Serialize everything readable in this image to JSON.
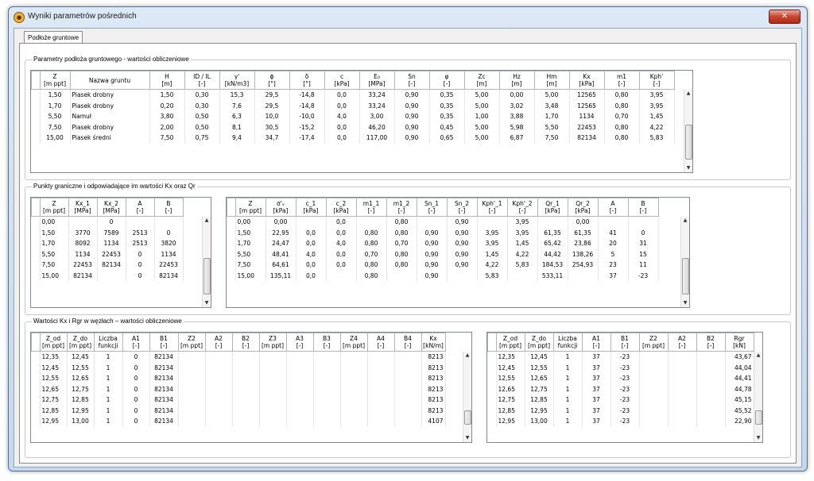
{
  "window": {
    "title": "Wyniki parametrów pośrednich",
    "close_label": "✕"
  },
  "tabs": [
    {
      "label": "Podłoże gruntowe"
    }
  ],
  "group1": {
    "label": "Parametry podłoża gruntowego - wartości obliczeniowe",
    "headers": [
      "Z\n[m ppt]",
      "Nazwa gruntu",
      "H\n[m]",
      "ID / IL\n[-]",
      "γ'\n[kN/m3]",
      "ϕ\n[°]",
      "δ\n[°]",
      "c\n[kPa]",
      "E₀\n[MPa]",
      "Sn\n[-]",
      "φ\n[-]",
      "Zc\n[m]",
      "Hz\n[m]",
      "Hm\n[m]",
      "Kx\n[kPa]",
      "m1\n[-]",
      "Kph'\n[-]"
    ],
    "rows": [
      [
        "1,50",
        "Piasek drobny",
        "1,50",
        "0,30",
        "15,3",
        "29,5",
        "-14,8",
        "0,0",
        "33,24",
        "0,90",
        "0,35",
        "5,00",
        "0,00",
        "5,00",
        "12565",
        "0,80",
        "3,95"
      ],
      [
        "1,70",
        "Piasek drobny",
        "0,20",
        "0,30",
        "7,6",
        "29,5",
        "-14,8",
        "0,0",
        "33,24",
        "0,90",
        "0,35",
        "5,00",
        "3,02",
        "3,48",
        "12565",
        "0,80",
        "3,95"
      ],
      [
        "5,50",
        "Namuł",
        "3,80",
        "0,50",
        "6,3",
        "10,0",
        "-10,0",
        "4,0",
        "3,00",
        "0,90",
        "0,35",
        "1,00",
        "3,88",
        "1,70",
        "1134",
        "0,70",
        "1,45"
      ],
      [
        "7,50",
        "Piasek drobny",
        "2,00",
        "0,50",
        "8,1",
        "30,5",
        "-15,2",
        "0,0",
        "46,20",
        "0,90",
        "0,45",
        "5,00",
        "5,98",
        "5,50",
        "22453",
        "0,80",
        "4,22"
      ],
      [
        "15,00",
        "Piasek średni",
        "7,50",
        "0,75",
        "9,4",
        "34,7",
        "-17,4",
        "0,0",
        "117,00",
        "0,90",
        "0,65",
        "5,00",
        "6,87",
        "7,50",
        "82134",
        "0,80",
        "5,83"
      ]
    ]
  },
  "group2": {
    "label": "Punkty graniczne i odpowiadające im wartości Kx oraz Qr",
    "left_headers": [
      "Z\n[m ppt]",
      "Kx_1\n[MPa]",
      "Kx_2\n[MPa]",
      "A\n[-]",
      "B\n[-]"
    ],
    "left_rows": [
      [
        "0,00",
        "",
        "0",
        "",
        ""
      ],
      [
        "1,50",
        "3770",
        "7589",
        "2513",
        "0"
      ],
      [
        "1,70",
        "8092",
        "1134",
        "2513",
        "3820"
      ],
      [
        "5,50",
        "1134",
        "22453",
        "0",
        "1134"
      ],
      [
        "7,50",
        "22453",
        "82134",
        "0",
        "22453"
      ],
      [
        "15,00",
        "82134",
        "",
        "0",
        "82134"
      ]
    ],
    "right_headers": [
      "Z\n[m ppt]",
      "σ'ᵥ\n[kPa]",
      "c_1\n[kPa]",
      "c_2\n[kPa]",
      "m1_1\n[-]",
      "m1_2\n[-]",
      "Sn_1\n[-]",
      "Sn_2\n[-]",
      "Kph'_1\n[-]",
      "Kph'_2\n[-]",
      "Qr_1\n[kPa]",
      "Qr_2\n[kPa]",
      "A\n[-]",
      "B\n[-]"
    ],
    "right_rows": [
      [
        "0,00",
        "0,00",
        "",
        "0,0",
        "",
        "0,80",
        "",
        "0,90",
        "",
        "3,95",
        "",
        "0,00",
        "",
        ""
      ],
      [
        "1,50",
        "22,95",
        "0,0",
        "0,0",
        "0,80",
        "0,80",
        "0,90",
        "0,90",
        "3,95",
        "3,95",
        "61,35",
        "61,35",
        "41",
        "0"
      ],
      [
        "1,70",
        "24,47",
        "0,0",
        "4,0",
        "0,80",
        "0,70",
        "0,90",
        "0,90",
        "3,95",
        "1,45",
        "65,42",
        "23,86",
        "20",
        "31"
      ],
      [
        "5,50",
        "48,41",
        "4,0",
        "0,0",
        "0,70",
        "0,80",
        "0,90",
        "0,90",
        "1,45",
        "4,22",
        "44,42",
        "138,26",
        "5",
        "15"
      ],
      [
        "7,50",
        "64,61",
        "0,0",
        "0,0",
        "0,80",
        "0,80",
        "0,90",
        "0,90",
        "4,22",
        "5,83",
        "184,53",
        "254,93",
        "23",
        "11"
      ],
      [
        "15,00",
        "135,11",
        "0,0",
        "",
        "0,80",
        "",
        "0,90",
        "",
        "5,83",
        "",
        "533,11",
        "",
        "37",
        "-23"
      ]
    ]
  },
  "group3": {
    "label": "Wartości Kx i Rgr w węzłach – wartości obliczeniowe",
    "left_headers": [
      "Z_od\n[m ppt]",
      "Z_do\n[m ppt]",
      "Liczba\nfunkcji",
      "A1\n[-]",
      "B1\n[-]",
      "Z2\n[m ppt]",
      "A2\n[-]",
      "B2\n[-]",
      "Z3\n[m ppt]",
      "A3\n[-]",
      "B3\n[-]",
      "Z4\n[m ppt]",
      "A4\n[-]",
      "B4\n[-]",
      "Kx\n[kN/m]"
    ],
    "left_rows": [
      [
        "12,35",
        "12,45",
        "1",
        "0",
        "82134",
        "",
        "",
        "",
        "",
        "",
        "",
        "",
        "",
        "",
        "8213"
      ],
      [
        "12,45",
        "12,55",
        "1",
        "0",
        "82134",
        "",
        "",
        "",
        "",
        "",
        "",
        "",
        "",
        "",
        "8213"
      ],
      [
        "12,55",
        "12,65",
        "1",
        "0",
        "82134",
        "",
        "",
        "",
        "",
        "",
        "",
        "",
        "",
        "",
        "8213"
      ],
      [
        "12,65",
        "12,75",
        "1",
        "0",
        "82134",
        "",
        "",
        "",
        "",
        "",
        "",
        "",
        "",
        "",
        "8213"
      ],
      [
        "12,75",
        "12,85",
        "1",
        "0",
        "82134",
        "",
        "",
        "",
        "",
        "",
        "",
        "",
        "",
        "",
        "8213"
      ],
      [
        "12,85",
        "12,95",
        "1",
        "0",
        "82134",
        "",
        "",
        "",
        "",
        "",
        "",
        "",
        "",
        "",
        "8213"
      ],
      [
        "12,95",
        "13,00",
        "1",
        "0",
        "82134",
        "",
        "",
        "",
        "",
        "",
        "",
        "",
        "",
        "",
        "4107"
      ]
    ],
    "right_headers": [
      "Z_od\n[m ppt]",
      "Z_do\n[m ppt]",
      "Liczba\nfunkcji",
      "A1\n[-]",
      "B1\n[-]",
      "Z2\n[m ppt]",
      "A2\n[-]",
      "B2\n[-]",
      "Rgr\n[kN]"
    ],
    "right_rows": [
      [
        "12,35",
        "12,45",
        "1",
        "37",
        "-23",
        "",
        "",
        "",
        "43,67"
      ],
      [
        "12,45",
        "12,55",
        "1",
        "37",
        "-23",
        "",
        "",
        "",
        "44,04"
      ],
      [
        "12,55",
        "12,65",
        "1",
        "37",
        "-23",
        "",
        "",
        "",
        "44,41"
      ],
      [
        "12,65",
        "12,75",
        "1",
        "37",
        "-23",
        "",
        "",
        "",
        "44,78"
      ],
      [
        "12,75",
        "12,85",
        "1",
        "37",
        "-23",
        "",
        "",
        "",
        "45,15"
      ],
      [
        "12,85",
        "12,95",
        "1",
        "37",
        "-23",
        "",
        "",
        "",
        "45,52"
      ],
      [
        "12,95",
        "13,00",
        "1",
        "37",
        "-23",
        "",
        "",
        "",
        "22,90"
      ]
    ]
  }
}
